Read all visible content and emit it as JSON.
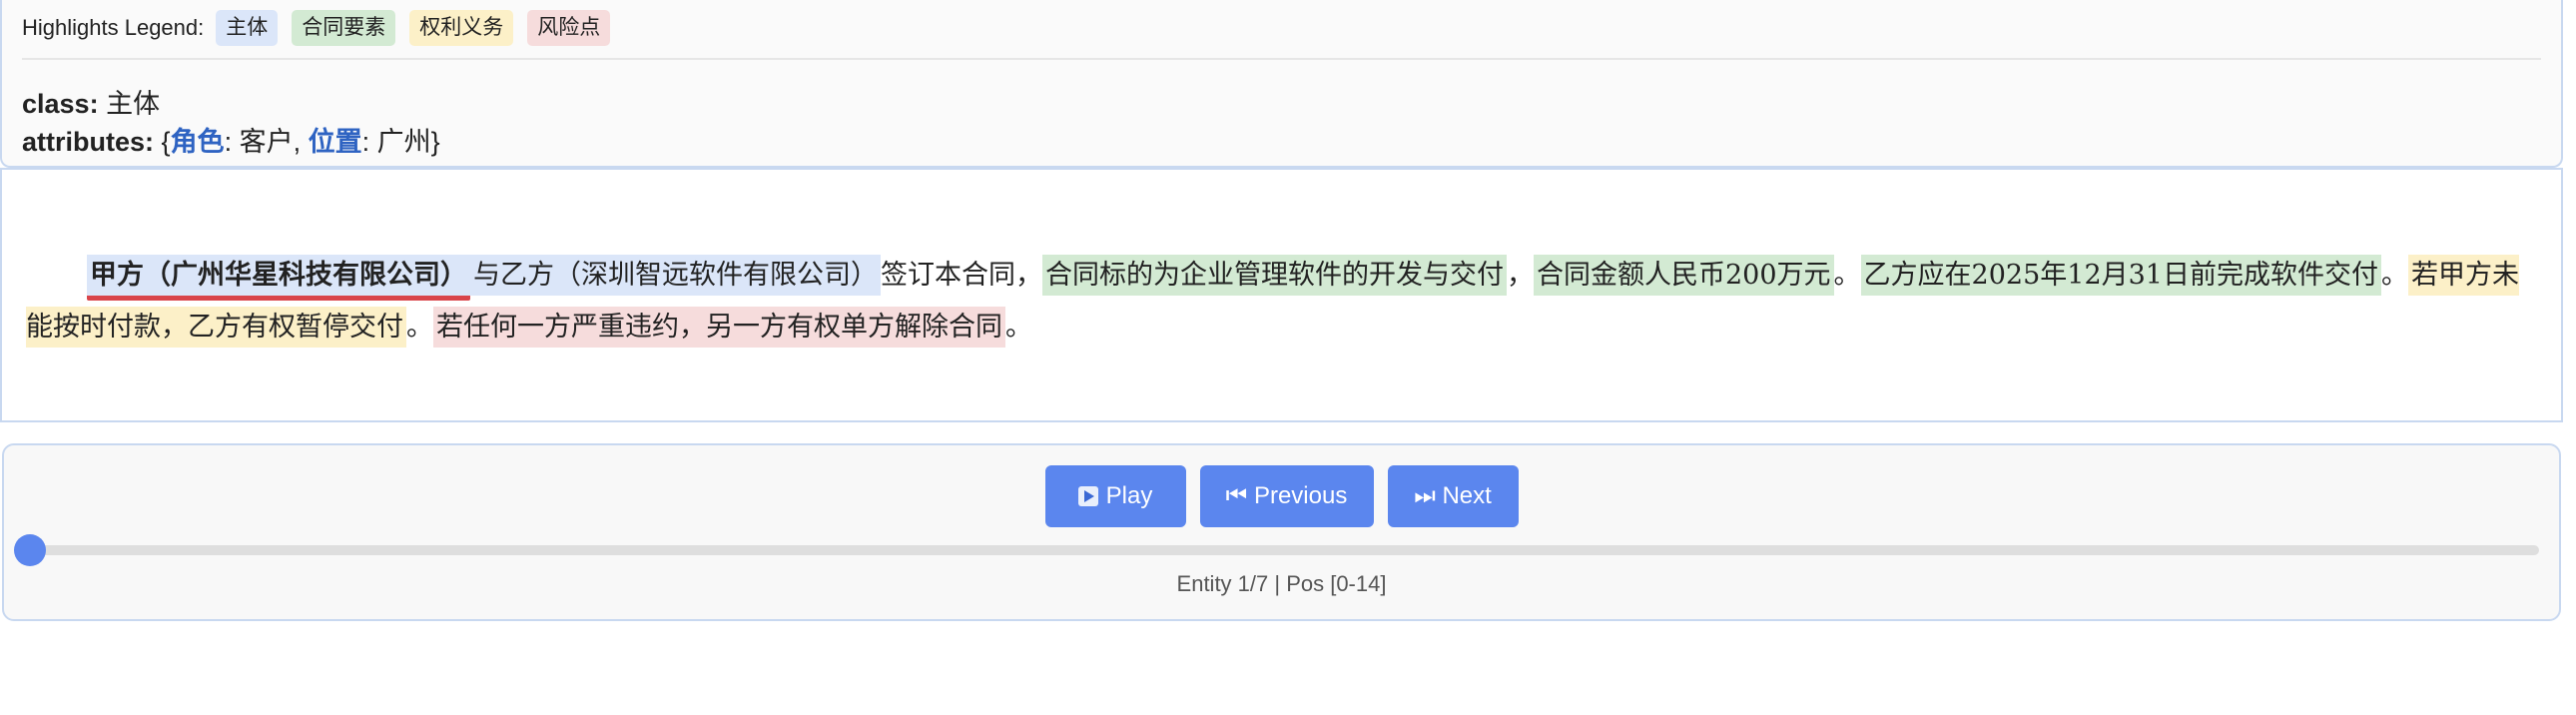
{
  "legend": {
    "title": "Highlights Legend:",
    "items": [
      {
        "label": "主体",
        "color": "#dbe6f9"
      },
      {
        "label": "合同要素",
        "color": "#d3ead3"
      },
      {
        "label": "权利义务",
        "color": "#fcf0c8"
      },
      {
        "label": "风险点",
        "color": "#f6dcdc"
      }
    ]
  },
  "entity_info": {
    "class_label": "class:",
    "class_value": "主体",
    "attributes_label": "attributes:",
    "attr_open": "{",
    "attr_close": "}",
    "attributes": [
      {
        "key": "角色",
        "value": "客户"
      },
      {
        "key": "位置",
        "value": "广州"
      }
    ]
  },
  "document": {
    "segments": [
      {
        "text": "甲方（广州华星科技有限公司）",
        "highlight": "主体",
        "active": true
      },
      {
        "text": "与乙方（深圳智远软件有限公司）",
        "highlight": "主体"
      },
      {
        "text": "签订本合同，"
      },
      {
        "text": "合同标的为企业管理软件的开发与交付",
        "highlight": "合同要素"
      },
      {
        "text": "，"
      },
      {
        "text": "合同金额人民币200万元",
        "highlight": "合同要素"
      },
      {
        "text": "。"
      },
      {
        "text": "乙方应在2025年12月31日前完成软件交付",
        "highlight": "合同要素"
      },
      {
        "text": "。"
      },
      {
        "text": "若甲方未能按时付款，乙方有权暂停交付",
        "highlight": "权利义务"
      },
      {
        "text": "。"
      },
      {
        "text": "若任何一方严重违约，另一方有权单方解除合同",
        "highlight": "风险点"
      },
      {
        "text": "。"
      }
    ]
  },
  "controls": {
    "play_label": "Play",
    "previous_label": "⏮ Previous",
    "next_label": "⏭ Next",
    "progress": 0,
    "status": "Entity 1/7 | Pos [0-14]"
  }
}
